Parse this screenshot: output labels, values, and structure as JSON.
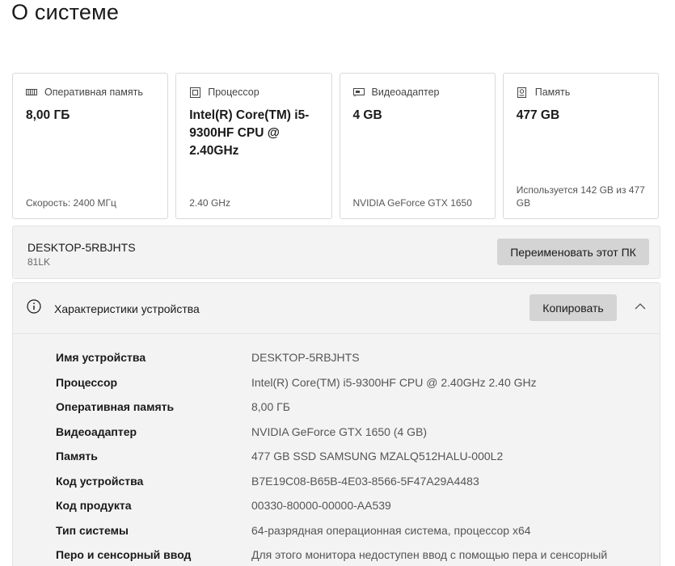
{
  "page": {
    "title": "О системе"
  },
  "cards": [
    {
      "icon": "ram-icon",
      "label": "Оперативная память",
      "value": "8,00 ГБ",
      "footer": "Скорость: 2400 МГц"
    },
    {
      "icon": "processor-icon",
      "label": "Процессор",
      "value": "Intel(R) Core(TM) i5-9300HF CPU @ 2.40GHz",
      "footer": "2.40 GHz"
    },
    {
      "icon": "gpu-icon",
      "label": "Видеоадаптер",
      "value": "4 GB",
      "footer": "NVIDIA GeForce GTX 1650"
    },
    {
      "icon": "storage-icon",
      "label": "Память",
      "value": "477 GB",
      "footer": "Используется 142 GB из 477 GB"
    }
  ],
  "device": {
    "name": "DESKTOP-5RBJHTS",
    "model": "81LK",
    "rename_label": "Переименовать этот ПК"
  },
  "specs": {
    "title": "Характеристики устройства",
    "copy_label": "Копировать",
    "rows": [
      {
        "key": "Имя устройства",
        "value": "DESKTOP-5RBJHTS"
      },
      {
        "key": "Процессор",
        "value": "Intel(R) Core(TM) i5-9300HF CPU @ 2.40GHz   2.40 GHz"
      },
      {
        "key": "Оперативная память",
        "value": "8,00 ГБ"
      },
      {
        "key": "Видеоадаптер",
        "value": "NVIDIA GeForce GTX 1650 (4 GB)"
      },
      {
        "key": "Память",
        "value": "477 GB SSD SAMSUNG MZALQ512HALU-000L2"
      },
      {
        "key": "Код устройства",
        "value": "B7E19C08-B65B-4E03-8566-5F47A29A4483"
      },
      {
        "key": "Код продукта",
        "value": "00330-80000-00000-AA539"
      },
      {
        "key": "Тип системы",
        "value": "64-разрядная операционная система, процессор x64"
      },
      {
        "key": "Перо и сенсорный ввод",
        "value": "Для этого монитора недоступен ввод с помощью пера и сенсорный"
      }
    ]
  },
  "colors": {
    "card_border": "#d9d9d9",
    "panel_bg": "#f3f3f3",
    "button_bg": "#d4d4d4"
  }
}
